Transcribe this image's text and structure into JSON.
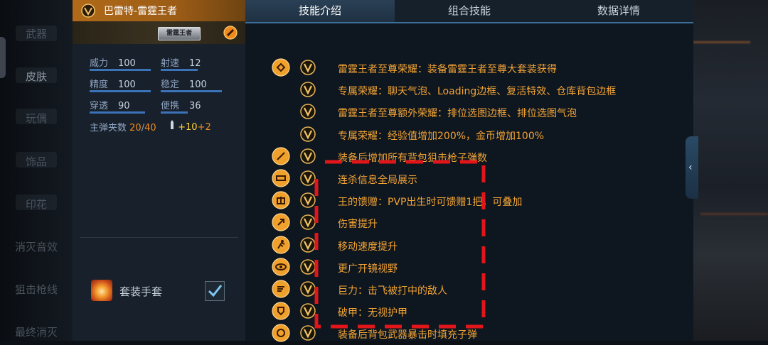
{
  "nav": {
    "items": [
      "武器",
      "皮肤",
      "玩偶",
      "饰品",
      "印花",
      "消灭音效",
      "狙击枪线",
      "最终消灭"
    ],
    "active_index": 1
  },
  "weapon": {
    "title": "巴雷特-雷霆王者",
    "badge": "雷霆王者",
    "stats": [
      {
        "label": "威力",
        "value": "100",
        "fill": 1.0
      },
      {
        "label": "射速",
        "value": "12",
        "fill": 0.6
      },
      {
        "label": "精度",
        "value": "100",
        "fill": 1.0
      },
      {
        "label": "稳定",
        "value": "100",
        "fill": 1.0
      },
      {
        "label": "穿透",
        "value": "90",
        "fill": 0.9
      },
      {
        "label": "便携",
        "value": "36",
        "fill": 0.45
      }
    ],
    "magazine": {
      "label": "主弹夹数",
      "current": "20",
      "sep": "/",
      "max": "40"
    },
    "ammo": {
      "plus1": "+10",
      "plus2": "+2"
    },
    "glove_label": "套装手套",
    "glove_checked": true
  },
  "tabs": [
    {
      "label": "技能介绍",
      "active": true
    },
    {
      "label": "组合技能",
      "active": false
    },
    {
      "label": "数据详情",
      "active": false
    }
  ],
  "skills": [
    {
      "icon": "crest-icon",
      "text": "雷霆王者至尊荣耀：装备雷霆王者至尊大套装获得"
    },
    {
      "icon": "",
      "text": "专属荣耀：聊天气泡、Loading边框、复活特效、仓库背包边框"
    },
    {
      "icon": "",
      "text": "雷霆王者至尊额外荣耀：排位选图边框、排位选图气泡"
    },
    {
      "icon": "",
      "text": "专属荣耀：经验值增加200%，金币增加100%"
    },
    {
      "icon": "sniper-ammo-icon",
      "text": "装备后增加所有背包狙击枪子弹数"
    },
    {
      "icon": "killstreak-icon",
      "text": "连杀信息全局展示"
    },
    {
      "icon": "gift-icon",
      "text": "王的馈赠：PVP出生时可馈赠1把，可叠加"
    },
    {
      "icon": "damage-icon",
      "text": "伤害提升"
    },
    {
      "icon": "running-man-icon",
      "text": "移动速度提升"
    },
    {
      "icon": "scope-eye-icon",
      "text": "更广开镜视野"
    },
    {
      "icon": "knockback-icon",
      "text": "巨力：击飞被打中的敌人"
    },
    {
      "icon": "armor-break-icon",
      "text": "破甲：无视护甲"
    },
    {
      "icon": "crit-reload-icon",
      "text": "装备后背包武器暴击时填充子弹"
    }
  ],
  "colors": {
    "accent_orange": "#f2a434",
    "title_bar": "#b06a18",
    "tab_active": "#2a4055",
    "annotation_red": "#e0161a"
  }
}
